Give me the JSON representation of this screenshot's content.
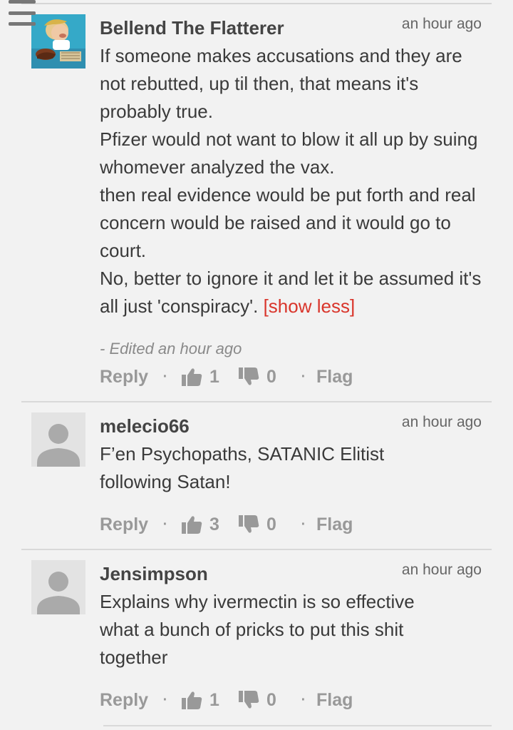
{
  "comments": [
    {
      "author": "Bellend The Flatterer",
      "time": "an hour ago",
      "lines": [
        "If someone makes accusations and they are not rebutted, up til then, that means it's probably true.",
        "Pfizer would not want to blow it all up by suing whomever analyzed the vax.",
        "then real evidence would be put forth and real concern would be raised and it would go to court.",
        "No, better to ignore it and let it be assumed it's all just 'conspiracy'. "
      ],
      "show_less": "[show less]",
      "edited": "- Edited an hour ago",
      "reply": "Reply",
      "up": "1",
      "down": "0",
      "flag": "Flag"
    },
    {
      "author": "melecio66",
      "time": "an hour ago",
      "text": "F’en Psychopaths, SATANIC Elitist following Satan!",
      "reply": "Reply",
      "up": "3",
      "down": "0",
      "flag": "Flag"
    },
    {
      "author": "Jensimpson",
      "time": "an hour ago",
      "text": "Explains why ivermectin is so effective what a bunch of pricks to put this shit together",
      "reply": "Reply",
      "up": "1",
      "down": "0",
      "flag": "Flag"
    }
  ],
  "separator": "·",
  "colors": {
    "accent": "#d9352b",
    "muted": "#999999",
    "background": "#f2f2f2"
  },
  "icons": {
    "menu": "hamburger-menu-icon",
    "up": "thumbs-up-icon",
    "down": "thumbs-down-icon",
    "avatar": "default-user-icon"
  }
}
